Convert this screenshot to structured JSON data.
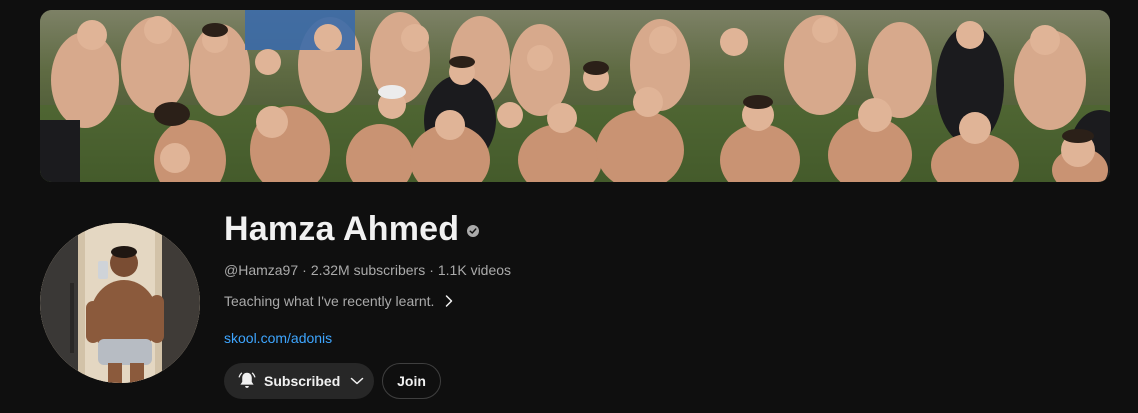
{
  "channel": {
    "name": "Hamza Ahmed",
    "handle": "@Hamza97",
    "subscribers": "2.32M subscribers",
    "videos": "1.1K videos",
    "separator": "·",
    "description": "Teaching what I've recently learnt.",
    "link": "skool.com/adonis"
  },
  "actions": {
    "subscribed_label": "Subscribed",
    "join_label": "Join"
  },
  "icons": {
    "verified": "verified-check-icon",
    "bell": "bell-notification-icon",
    "chevron_down": "chevron-down-icon",
    "chevron_right": "chevron-right-icon"
  },
  "colors": {
    "background": "#0f0f0f",
    "text_primary": "#f1f1f1",
    "text_secondary": "#aaaaaa",
    "link": "#3ea6ff",
    "button_bg": "#272727"
  }
}
